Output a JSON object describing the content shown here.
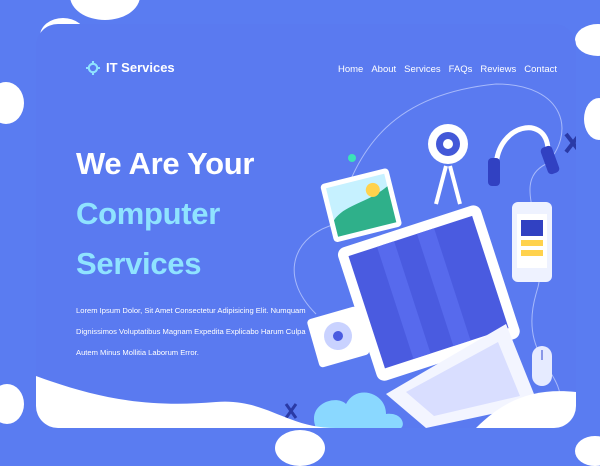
{
  "brand": {
    "name": "IT Services",
    "icon": "gear-icon"
  },
  "nav": {
    "items": [
      {
        "label": "Home"
      },
      {
        "label": "About"
      },
      {
        "label": "Services"
      },
      {
        "label": "FAQs"
      },
      {
        "label": "Reviews"
      },
      {
        "label": "Contact"
      }
    ]
  },
  "hero": {
    "line1": "We Are Your",
    "line2": "Computer",
    "line3": "Services",
    "description": "Lorem Ipsum Dolor, Sit Amet Consectetur Adipisicing Elit. Numquam Dignissimos Voluptatibus Magnam Expedita Explicabo Harum Culpa Autem Minus Mollitia Laborum Error."
  },
  "colors": {
    "background": "#5a7cf1",
    "accent": "#8fe3ff",
    "text": "#ffffff"
  }
}
